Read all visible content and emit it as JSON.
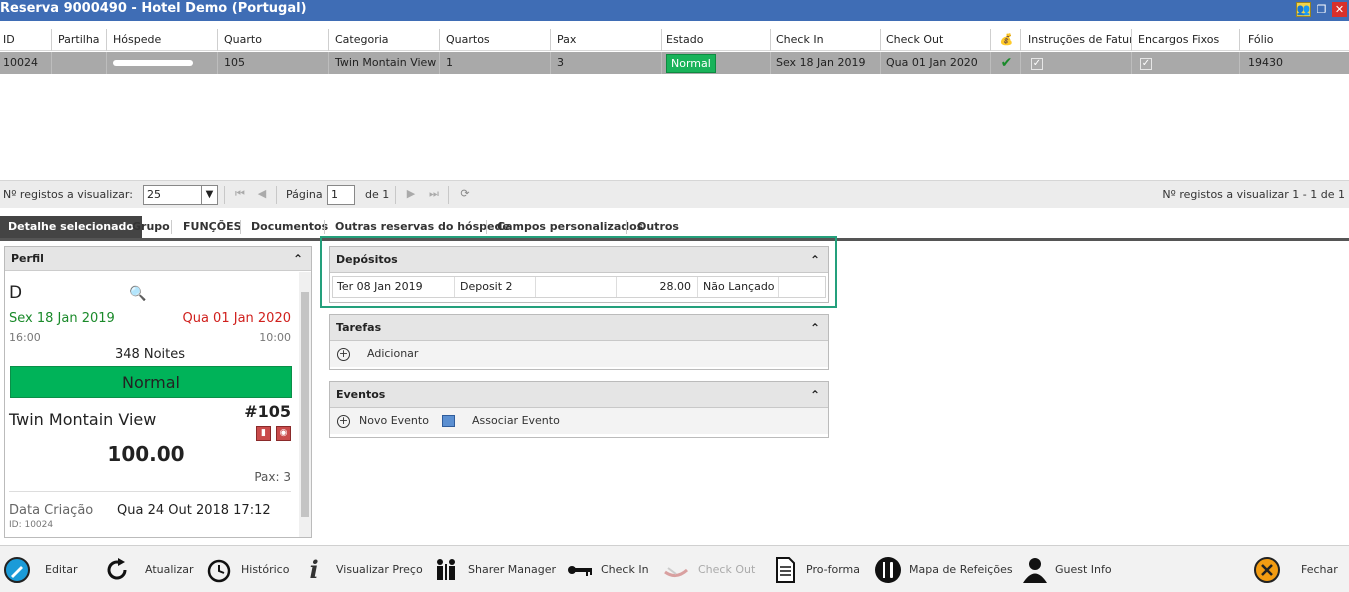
{
  "window": {
    "title": "Reserva 9000490 - Hotel Demo (Portugal)"
  },
  "grid": {
    "headers": [
      "ID",
      "Partilha",
      "Hóspede",
      "Quarto",
      "Categoria",
      "Quartos",
      "Pax",
      "Estado",
      "Check In",
      "Check Out",
      "",
      "Instruções de Faturação",
      "Encargos Fixos",
      "Fólio"
    ],
    "row": {
      "id": "10024",
      "partilha": "",
      "hospede": "",
      "quarto": "105",
      "categoria": "Twin Montain View",
      "quartos": "1",
      "pax": "3",
      "estado": "Normal",
      "check_in": "Sex 18 Jan 2019",
      "check_out": "Qua 01 Jan 2020",
      "folio": "19430"
    }
  },
  "pager": {
    "records_label": "Nº registos a visualizar:",
    "records_value": "25",
    "page_label": "Página",
    "page_value": "1",
    "of_label": "de 1",
    "summary": "Nº registos a visualizar 1 - 1 de 1"
  },
  "tabs": [
    {
      "label": "Detalhe selecionado",
      "active": true
    },
    {
      "label": "Grupo"
    },
    {
      "label": "FUNÇÕES"
    },
    {
      "label": "Documentos"
    },
    {
      "label": "Outras reservas do hóspede"
    },
    {
      "label": "Campos personalizados"
    },
    {
      "label": "Outros"
    }
  ],
  "profile": {
    "header": "Perfil",
    "check_in_date": "Sex 18 Jan 2019",
    "check_out_date": "Qua 01 Jan 2020",
    "check_in_time": "16:00",
    "check_out_time": "10:00",
    "nights": "348 Noites",
    "status": "Normal",
    "category": "Twin Montain View",
    "room": "#105",
    "price": "100.00",
    "pax": "Pax: 3",
    "created_label": "Data Criação",
    "created_value": "Qua 24 Out 2018 17:12",
    "id_label": "ID: 10024"
  },
  "depositos": {
    "header": "Depósitos",
    "row": {
      "date": "Ter 08 Jan 2019",
      "name": "Deposit 2",
      "blank": "",
      "amount": "28.00",
      "status": "Não Lançado"
    }
  },
  "tarefas": {
    "header": "Tarefas",
    "add": "Adicionar"
  },
  "eventos": {
    "header": "Eventos",
    "new": "Novo Evento",
    "associate": "Associar Evento"
  },
  "toolbar": {
    "editar": "Editar",
    "atualizar": "Atualizar",
    "historico": "Histórico",
    "preco": "Visualizar Preço",
    "sharer": "Sharer Manager",
    "checkin": "Check In",
    "checkout": "Check Out",
    "proforma": "Pro-forma",
    "refeicoes": "Mapa de Refeições",
    "guest": "Guest Info",
    "fechar": "Fechar"
  }
}
